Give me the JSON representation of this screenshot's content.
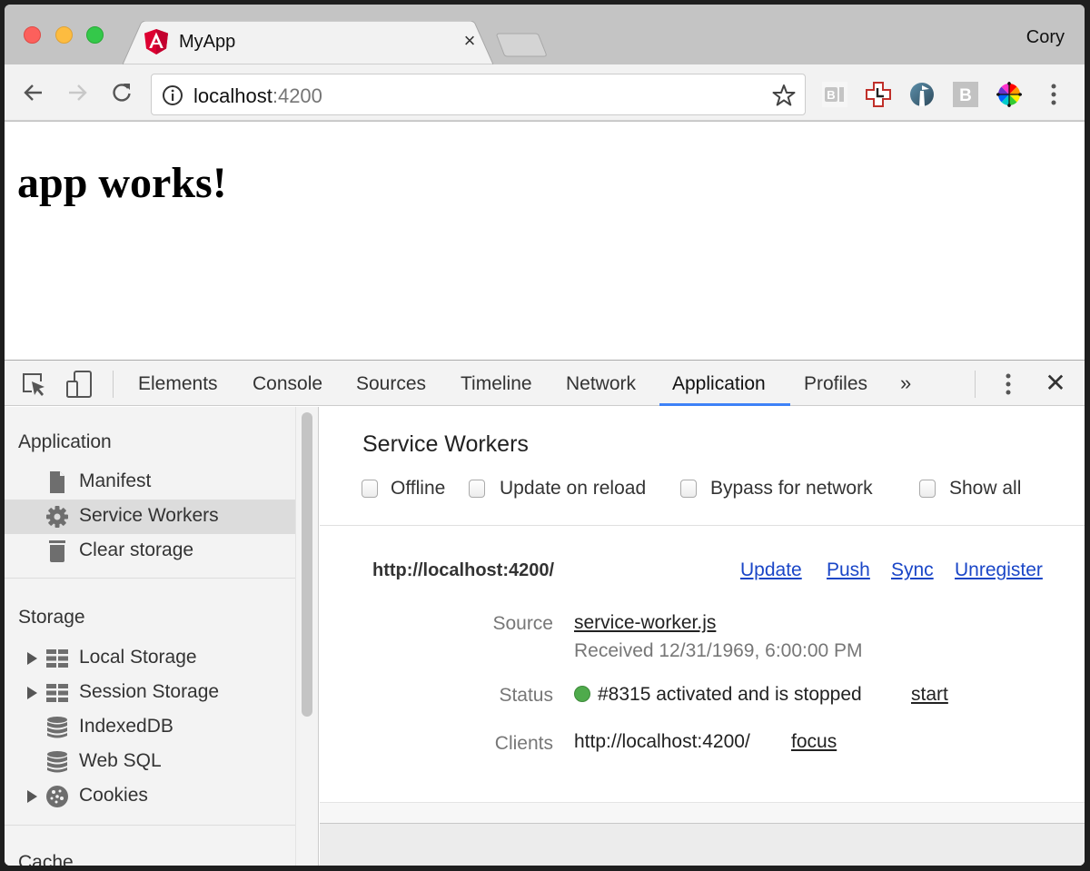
{
  "browser": {
    "tab": {
      "title": "MyApp",
      "favicon": "angular-icon",
      "close_label": "×"
    },
    "profile_name": "Cory",
    "omnibox": {
      "host": "localhost",
      "port": ":4200",
      "icon": "info-icon"
    },
    "extensions": [
      {
        "name": "bi-extension-icon"
      },
      {
        "name": "clock-cross-extension-icon"
      },
      {
        "name": "lighthouse-extension-icon"
      },
      {
        "name": "b-extension-icon"
      },
      {
        "name": "color-wheel-extension-icon"
      }
    ]
  },
  "page": {
    "heading": "app works!"
  },
  "devtools": {
    "tabs": [
      {
        "label": "Elements"
      },
      {
        "label": "Console"
      },
      {
        "label": "Sources"
      },
      {
        "label": "Timeline"
      },
      {
        "label": "Network"
      },
      {
        "label": "Application",
        "active": true
      },
      {
        "label": "Profiles"
      }
    ],
    "more_tabs_label": "»",
    "close_label": "✕",
    "sidebar": {
      "sections": [
        {
          "title": "Application",
          "items": [
            {
              "label": "Manifest",
              "icon": "document-icon"
            },
            {
              "label": "Service Workers",
              "icon": "gear-icon",
              "selected": true
            },
            {
              "label": "Clear storage",
              "icon": "trash-icon"
            }
          ]
        },
        {
          "title": "Storage",
          "items": [
            {
              "label": "Local Storage",
              "icon": "grid-icon",
              "expandable": true
            },
            {
              "label": "Session Storage",
              "icon": "grid-icon",
              "expandable": true
            },
            {
              "label": "IndexedDB",
              "icon": "database-icon"
            },
            {
              "label": "Web SQL",
              "icon": "database-icon"
            },
            {
              "label": "Cookies",
              "icon": "cookie-icon",
              "expandable": true
            }
          ]
        },
        {
          "title": "Cache",
          "items": []
        }
      ]
    },
    "service_workers": {
      "title": "Service Workers",
      "options": [
        {
          "label": "Offline",
          "checked": false
        },
        {
          "label": "Update on reload",
          "checked": false
        },
        {
          "label": "Bypass for network",
          "checked": false
        },
        {
          "label": "Show all",
          "checked": false
        }
      ],
      "registration": {
        "origin": "http://localhost:4200/",
        "actions": [
          "Update",
          "Push",
          "Sync",
          "Unregister"
        ],
        "source_label": "Source",
        "source_file": "service-worker.js",
        "received": "Received 12/31/1969, 6:00:00 PM",
        "status_label": "Status",
        "status_text": "#8315 activated and is stopped",
        "status_color": "#4fab4c",
        "status_action": "start",
        "clients_label": "Clients",
        "client_url": "http://localhost:4200/",
        "client_action": "focus"
      }
    }
  }
}
